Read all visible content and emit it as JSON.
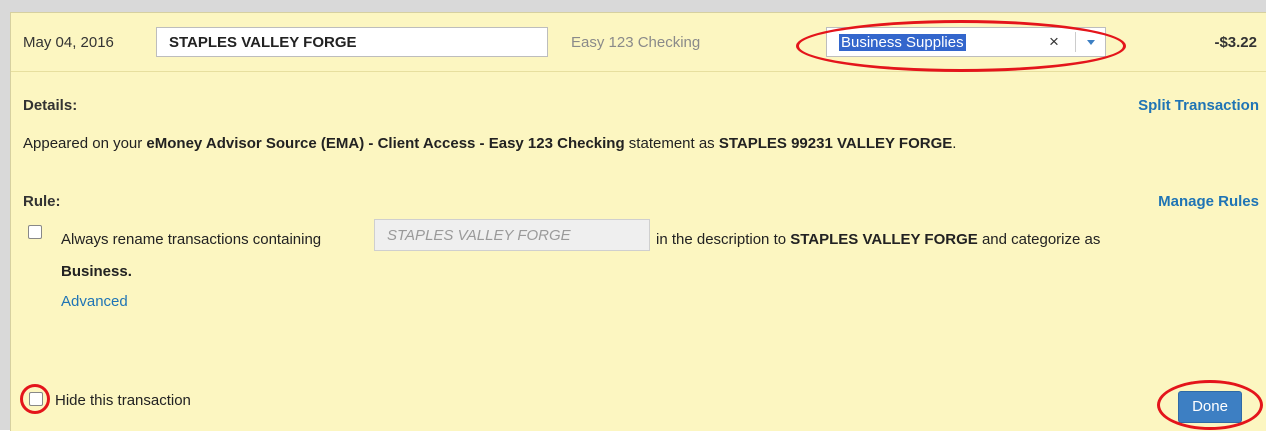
{
  "transaction": {
    "date": "May 04, 2016",
    "name_value": "STAPLES VALLEY FORGE",
    "account": "Easy 123 Checking",
    "category": "Business Supplies",
    "clear_glyph": "×",
    "amount": "-$3.22"
  },
  "details": {
    "label": "Details:",
    "split_link": "Split Transaction",
    "text_prefix": "Appeared on your ",
    "source": "eMoney Advisor Source (EMA) - Client Access - Easy 123 Checking",
    "text_middle": " statement as ",
    "statement_name": "STAPLES 99231 VALLEY FORGE",
    "text_suffix": "."
  },
  "rule": {
    "label": "Rule:",
    "manage_link": "Manage Rules",
    "text_before": "Always rename transactions containing",
    "input_value": "STAPLES VALLEY FORGE",
    "text_after_1": " in the description to ",
    "rename_to": "STAPLES VALLEY FORGE",
    "text_after_2": " and categorize as",
    "category": "Business",
    "category_suffix": ".",
    "advanced_link": "Advanced"
  },
  "footer": {
    "hide_label": "Hide this transaction",
    "done_label": "Done"
  },
  "colors": {
    "panel_bg": "#fcf6c1",
    "link": "#1f74b5",
    "highlight": "#3366cc",
    "annotation": "#e4151b",
    "button": "#3d7fc3"
  },
  "icons": {
    "clear": "close-icon",
    "dropdown": "chevron-down-icon"
  }
}
